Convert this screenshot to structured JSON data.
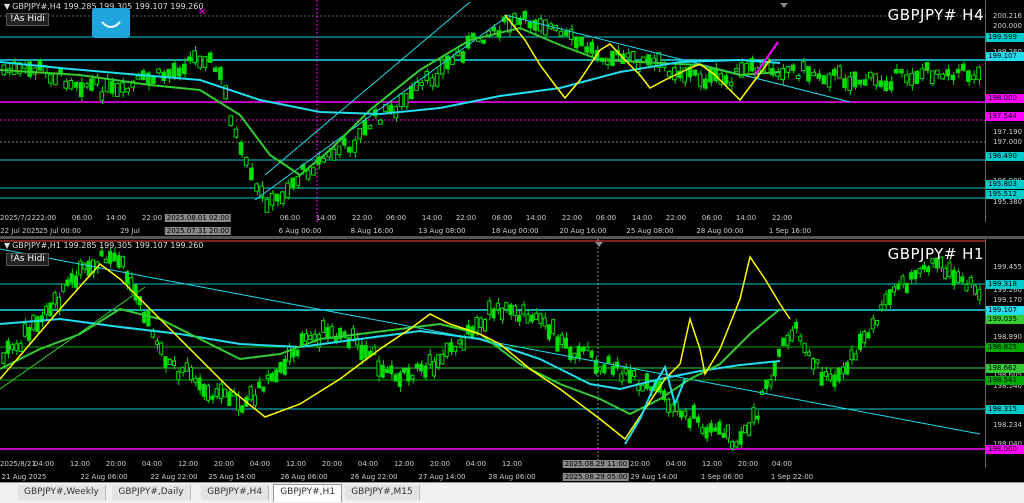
{
  "colors": {
    "background": "#000000",
    "candle": "#00dd00",
    "ma_fast": "#ffff00",
    "ma_green": "#33cc33",
    "ma_cyan": "#22ddee",
    "hline_magenta": "#ff00ff",
    "hline_cyan": "#00cccc",
    "hline_green": "#00aa00"
  },
  "top_pane": {
    "info": "GBPJPY#,H4  199.285 199.305 199.107 199.260",
    "as_button": "!As Hidi",
    "symbol_label": "GBPJPY# H4",
    "price_labels": [
      "200.216",
      "200.000",
      "199.260",
      "198.110",
      "197.190",
      "197.000",
      "196.000",
      "195.380"
    ],
    "price_tags": [
      {
        "text": "199.599",
        "color": "#00cccc"
      },
      {
        "text": "199.107",
        "color": "#22ddee"
      },
      {
        "text": "198.000",
        "color": "#ff00ff"
      },
      {
        "text": "197.544",
        "color": "#ff00ff"
      },
      {
        "text": "196.490",
        "color": "#00cccc"
      },
      {
        "text": "195.803",
        "color": "#00cccc"
      },
      {
        "text": "195.512",
        "color": "#00cccc"
      }
    ],
    "time_labels": [
      {
        "text": "2025/7/22",
        "hl": false
      },
      {
        "text": "22:00",
        "hl": false
      },
      {
        "text": "06:00",
        "hl": false
      },
      {
        "text": "14:00",
        "hl": false
      },
      {
        "text": "22:00",
        "hl": false
      },
      {
        "text": "2025.08.01 02:00",
        "hl": true
      },
      {
        "text": "2025.07.31 20:00",
        "hl": true
      },
      {
        "text": "06:00",
        "hl": false
      },
      {
        "text": "14:00",
        "hl": false
      },
      {
        "text": "22:00",
        "hl": false
      },
      {
        "text": "06:00",
        "hl": false
      },
      {
        "text": "14:00",
        "hl": false
      },
      {
        "text": "22:00",
        "hl": false
      },
      {
        "text": "06:00",
        "hl": false
      },
      {
        "text": "14:00",
        "hl": false
      },
      {
        "text": "22:00",
        "hl": false
      },
      {
        "text": "06:00",
        "hl": false
      },
      {
        "text": "14:00",
        "hl": false
      },
      {
        "text": "22:00",
        "hl": false
      },
      {
        "text": "06:00",
        "hl": false
      },
      {
        "text": "14:00",
        "hl": false
      },
      {
        "text": "22:00",
        "hl": false
      }
    ],
    "date_labels": [
      "22 Jul 2025",
      "25 Jul 00:00",
      "29 Jul",
      "6 Aug 00:00",
      "8 Aug 16:00",
      "13 Aug 08:00",
      "18 Aug 00:00",
      "20 Aug 16:00",
      "25 Aug 08:00",
      "28 Aug 00:00",
      "1 Sep 16:00"
    ]
  },
  "bottom_pane": {
    "info": "GBPJPY#,H1  199.285 199.305 199.107 199.260",
    "as_button": "!As Hidi",
    "symbol_label": "GBPJPY# H1",
    "price_labels": [
      "199.455",
      "199.260",
      "199.170",
      "198.890",
      "198.605",
      "198.540",
      "198.234",
      "198.040"
    ],
    "price_tags": [
      {
        "text": "199.318",
        "color": "#00cccc"
      },
      {
        "text": "199.107",
        "color": "#22ddee"
      },
      {
        "text": "199.035",
        "color": "#33cc33"
      },
      {
        "text": "198.825",
        "color": "#00aa00"
      },
      {
        "text": "198.662",
        "color": "#33cc33"
      },
      {
        "text": "198.541",
        "color": "#00aa00"
      },
      {
        "text": "198.315",
        "color": "#00cccc"
      },
      {
        "text": "198.000",
        "color": "#ff00ff"
      }
    ],
    "time_labels": [
      {
        "text": "2025/8/21",
        "hl": false
      },
      {
        "text": "04:00",
        "hl": false
      },
      {
        "text": "12:00",
        "hl": false
      },
      {
        "text": "20:00",
        "hl": false
      },
      {
        "text": "04:00",
        "hl": false
      },
      {
        "text": "12:00",
        "hl": false
      },
      {
        "text": "20:00",
        "hl": false
      },
      {
        "text": "04:00",
        "hl": false
      },
      {
        "text": "12:00",
        "hl": false
      },
      {
        "text": "20:00",
        "hl": false
      },
      {
        "text": "04:00",
        "hl": false
      },
      {
        "text": "12:00",
        "hl": false
      },
      {
        "text": "20:00",
        "hl": false
      },
      {
        "text": "04:00",
        "hl": false
      },
      {
        "text": "12:00",
        "hl": false
      },
      {
        "text": "2025.08.29 11:00",
        "hl": true
      },
      {
        "text": "20:00",
        "hl": false
      },
      {
        "text": "04:00",
        "hl": false
      },
      {
        "text": "12:00",
        "hl": false
      },
      {
        "text": "20:00",
        "hl": false
      },
      {
        "text": "04:00",
        "hl": false
      }
    ],
    "date_labels": [
      "21 Aug 2025",
      "22 Aug 06:00",
      "22 Aug 22:00",
      "25 Aug 14:00",
      "26 Aug 06:00",
      "26 Aug 22:00",
      "27 Aug 14:00",
      "28 Aug 06:00",
      "2025.08.29 05:00",
      "29 Aug 14:00",
      "1 Sep 06:00",
      "1 Sep 22:00"
    ]
  },
  "tabs": [
    "GBPJPY#,Weekly",
    "GBPJPY#,Daily",
    "GBPJPY#,H4",
    "GBPJPY#,H1",
    "GBPJPY#,M15"
  ],
  "active_tab": "GBPJPY#,H1"
}
